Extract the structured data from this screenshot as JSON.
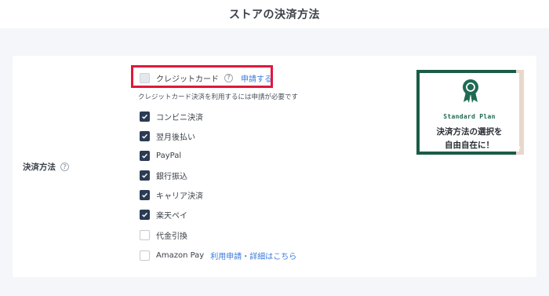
{
  "header": {
    "title": "ストアの決済方法"
  },
  "field": {
    "label": "決済方法"
  },
  "credit": {
    "label": "クレジットカード",
    "apply_link": "申請する",
    "note": "クレジットカード決済を利用するには申請が必要です"
  },
  "options": [
    {
      "label": "コンビニ決済",
      "checked": true
    },
    {
      "label": "翌月後払い",
      "checked": true
    },
    {
      "label": "PayPal",
      "checked": true
    },
    {
      "label": "銀行振込",
      "checked": true
    },
    {
      "label": "キャリア決済",
      "checked": true
    },
    {
      "label": "楽天ペイ",
      "checked": true
    },
    {
      "label": "代金引換",
      "checked": false
    },
    {
      "label": "Amazon Pay",
      "checked": false,
      "link": "利用申請・詳細はこちら"
    }
  ],
  "banner": {
    "plan": "Standard Plan",
    "line1": "決済方法の選択を",
    "line2": "自由自在に！",
    "icon": "ribbon-badge-icon"
  },
  "colors": {
    "accent": "#3c7be0",
    "checkbox": "#2b3b54",
    "highlight": "#e0183c",
    "brand_green": "#1b5c47"
  }
}
